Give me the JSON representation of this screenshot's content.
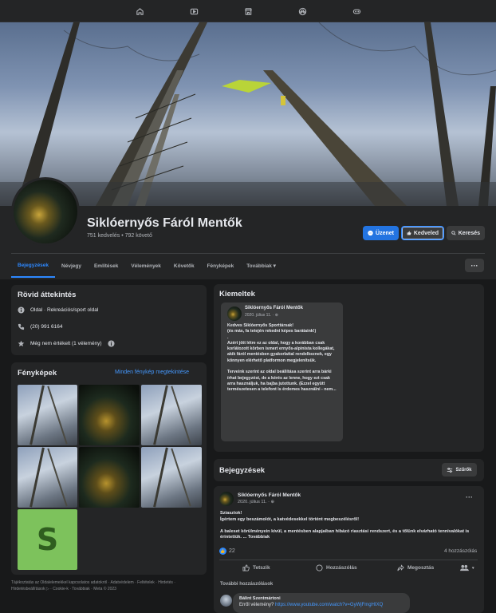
{
  "page": {
    "name": "Siklóernyős Fáról Mentők",
    "stats": "751 kedvelés • 792 követő"
  },
  "header_buttons": {
    "message": "Üzenet",
    "like": "Kedveled",
    "search": "Keresés"
  },
  "tabs": [
    "Bejegyzések",
    "Névjegy",
    "Említések",
    "Vélemények",
    "Követők",
    "Fényképek",
    "Továbbiak ▾"
  ],
  "more_button": "···",
  "intro": {
    "title": "Rövid áttekintés",
    "category": "Oldal · Rekreációs/sport oldal",
    "phone": "(20) 991 6164",
    "rating": "Még nem értékelt (1 vélemény)"
  },
  "photos": {
    "title": "Fényképek",
    "see_all": "Minden fénykép megtekintése",
    "tile_letter": "S"
  },
  "footer": "Tájékoztatás az Oldalelemekkel kapcsolatos adatokról · Adatvédelem · Feltételek · Hirdetés · Hirdetésbeállítások ▷ · Cookie-k · Továbbiak · Meta © 2023",
  "featured": {
    "title": "Kiemeltek",
    "post_author": "Siklóernyős Fáról Mentők",
    "post_date": "2020. július 11. · ⊕",
    "post_text": "Kedves Siklóernyős Sporttársak!\n(és más, fa tetején rekedni képes barátaink!)\n.\nAzért jött létre ez az oldal, hogy a korábban csak korlátozott körben ismert ernyős-alpinista kollegákat, akik fáról mentésben gyakorlattal rendelkeznek, egy könnyen elérhető platformon megjelenítsük.\n\nTerveink szerint az oldal beállítása szerint arra bárki írhat bejegyzést, de a kérés az lenne, hogy ezt csak arra használjuk, ha bajba jutottunk. (Ezzel együtt természetesen a telefont is érdemes használni - nem..."
  },
  "posts": {
    "title": "Bejegyzések",
    "filter": "Szűrők",
    "author": "Siklóernyős Fáról Mentők",
    "date": "2020. július 11. · ⊕",
    "menu": "···",
    "text": "Sziasztok!\nÍgértem egy beszámolót, a katvédesekkel történt megbeszélésről!\n\nA baleset körülményein kívül, a mentésben alapjaiban hibázó riasztási rendszert, és a tőlünk elvárható tennivalókat is érintettük. ...",
    "see_more": "Továbbiak",
    "likes": "22",
    "comments_count": "4 hozzászólás",
    "actions": {
      "like": "Tetszik",
      "comment": "Hozzászólás",
      "share": "Megosztás"
    },
    "more_comments": "További hozzászólások",
    "comment": {
      "name": "Bálint Szentmártoni",
      "text": "Erről vélemény? ",
      "link": "https://www.youtube.com/watch?v=GyWjFmgHIXQ"
    }
  },
  "colors": {
    "background": "#18191a",
    "card": "#242526",
    "accent": "#2d88ff",
    "button": "#3a3b3c"
  }
}
